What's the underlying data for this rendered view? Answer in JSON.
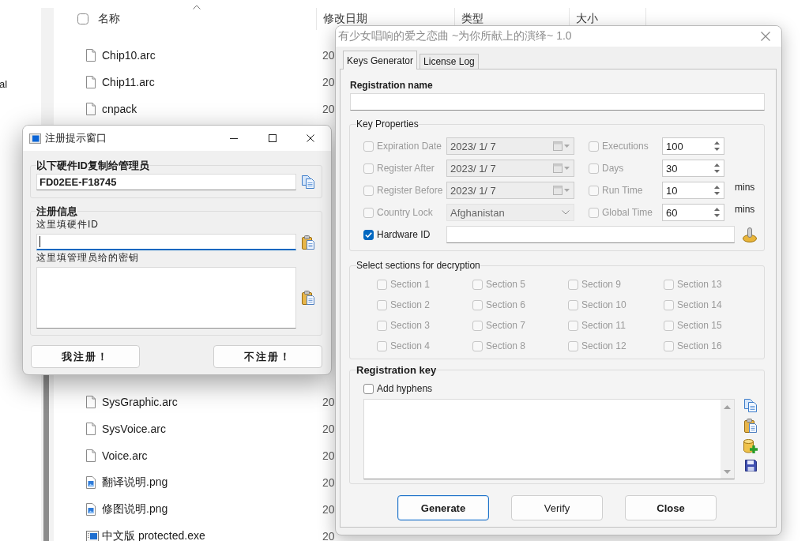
{
  "explorer": {
    "navigation": {
      "label": "al"
    },
    "select_all": {
      "checked": false
    },
    "columns": [
      {
        "label": "名称"
      },
      {
        "label": "修改日期"
      },
      {
        "label": "类型"
      },
      {
        "label": "大小"
      }
    ],
    "files": [
      {
        "name": "Chip10.arc",
        "kind": "document",
        "date": "20"
      },
      {
        "name": "Chip11.arc",
        "kind": "document",
        "date": "20"
      },
      {
        "name": "cnpack",
        "kind": "document",
        "date": "20"
      },
      {
        "name": "SysGraphic.arc",
        "kind": "document",
        "date": "20"
      },
      {
        "name": "SysVoice.arc",
        "kind": "document",
        "date": "20"
      },
      {
        "name": "Voice.arc",
        "kind": "document",
        "date": "20"
      },
      {
        "name": "翻译说明.png",
        "kind": "image",
        "date": "20"
      },
      {
        "name": "修图说明.png",
        "kind": "image",
        "date": "20"
      },
      {
        "name": "中文版 protected.exe",
        "kind": "program",
        "date": "20"
      }
    ]
  },
  "register_window": {
    "title": "注册提示窗口",
    "active": true,
    "hardware_group": {
      "title": "以下硬件ID复制给管理员",
      "value": "FD02EE-F18745"
    },
    "info_group": {
      "title": "注册信息",
      "fields": [
        {
          "label": "这里填硬件ID",
          "kind": "line",
          "focused": true
        },
        {
          "label": "这里填管理员给的密钥",
          "kind": "multiline",
          "focused": false
        }
      ]
    },
    "buttons": [
      {
        "label": "我注册！"
      },
      {
        "label": "不注册！"
      }
    ]
  },
  "keygen_window": {
    "title": "有少女唱响的爱之恋曲 ~为你所献上的演绎~ 1.0",
    "active": false,
    "tabs": [
      {
        "label": "Keys Generator",
        "selected": true
      },
      {
        "label": "License Log",
        "selected": false
      }
    ],
    "registration_name": {
      "label": "Registration name"
    },
    "key_properties": {
      "title": "Key Properties",
      "left_options": [
        {
          "label": "Expiration Date",
          "checked": false,
          "disabled": true,
          "kind": "date",
          "value": "2023/ 1/ 7"
        },
        {
          "label": "Register After",
          "checked": false,
          "disabled": true,
          "kind": "date",
          "value": "2023/ 1/ 7"
        },
        {
          "label": "Register Before",
          "checked": false,
          "disabled": true,
          "kind": "date",
          "value": "2023/ 1/ 7"
        },
        {
          "label": "Country Lock",
          "checked": false,
          "disabled": true,
          "kind": "dropdown",
          "value": "Afghanistan"
        },
        {
          "label": "Hardware ID",
          "checked": true,
          "disabled": false,
          "kind": "text"
        }
      ],
      "right_options": [
        {
          "label": "Executions",
          "checked": false,
          "disabled": true,
          "value": "100"
        },
        {
          "label": "Days",
          "checked": false,
          "disabled": true,
          "value": "30"
        },
        {
          "label": "Run Time",
          "checked": false,
          "disabled": true,
          "value": "10",
          "unit": "mins"
        },
        {
          "label": "Global Time",
          "checked": false,
          "disabled": true,
          "value": "60",
          "unit": "mins"
        }
      ]
    },
    "sections": {
      "title": "Select sections for decryption",
      "items": [
        {
          "label": "Section 1",
          "checked": false,
          "disabled": true
        },
        {
          "label": "Section 2",
          "checked": false,
          "disabled": true
        },
        {
          "label": "Section 3",
          "checked": false,
          "disabled": true
        },
        {
          "label": "Section 4",
          "checked": false,
          "disabled": true
        },
        {
          "label": "Section 5",
          "checked": false,
          "disabled": true
        },
        {
          "label": "Section 6",
          "checked": false,
          "disabled": true
        },
        {
          "label": "Section 7",
          "checked": false,
          "disabled": true
        },
        {
          "label": "Section 8",
          "checked": false,
          "disabled": true
        },
        {
          "label": "Section 9",
          "checked": false,
          "disabled": true
        },
        {
          "label": "Section 10",
          "checked": false,
          "disabled": true
        },
        {
          "label": "Section 11",
          "checked": false,
          "disabled": true
        },
        {
          "label": "Section 12",
          "checked": false,
          "disabled": true
        },
        {
          "label": "Section 13",
          "checked": false,
          "disabled": true
        },
        {
          "label": "Section 14",
          "checked": false,
          "disabled": true
        },
        {
          "label": "Section 15",
          "checked": false,
          "disabled": true
        },
        {
          "label": "Section 16",
          "checked": false,
          "disabled": true
        }
      ]
    },
    "registration_key": {
      "title": "Registration key",
      "hyphens": {
        "label": "Add hyphens",
        "checked": false,
        "disabled": false
      }
    },
    "buttons": [
      {
        "label": "Generate",
        "kind": "action",
        "default": true
      },
      {
        "label": "Verify",
        "kind": "plain",
        "default": false
      },
      {
        "label": "Close",
        "kind": "action",
        "default": false
      }
    ]
  }
}
